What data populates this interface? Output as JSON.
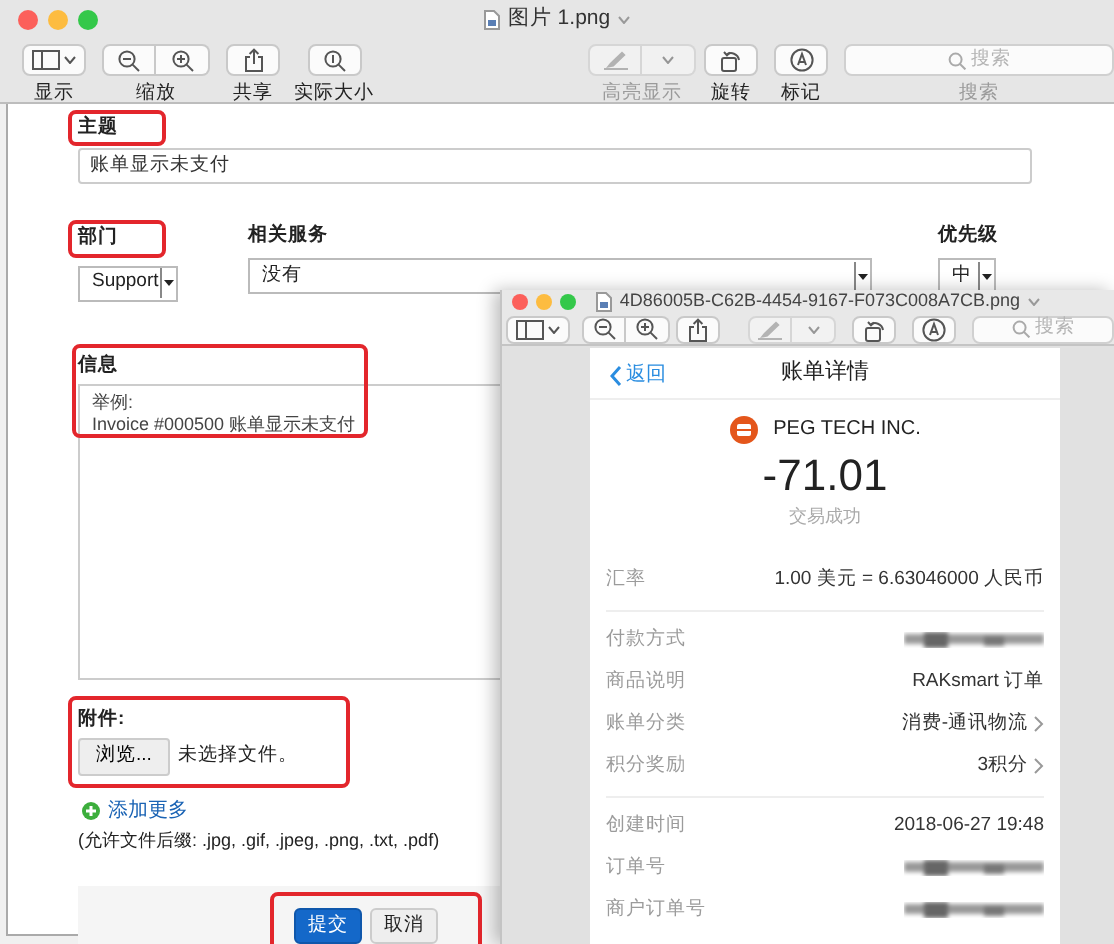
{
  "window": {
    "title": "图片 1.png"
  },
  "toolbar": [
    {
      "label": "显示",
      "kind": "sidebar",
      "disabled": false
    },
    {
      "label": "缩放",
      "kind": "zoom",
      "disabled": false
    },
    {
      "label": "共享",
      "kind": "share",
      "disabled": false
    },
    {
      "label": "实际大小",
      "kind": "actual",
      "disabled": false
    },
    {
      "label": "高亮显示",
      "kind": "highlight",
      "disabled": true
    },
    {
      "label": "旋转",
      "kind": "rotate",
      "disabled": false
    },
    {
      "label": "标记",
      "kind": "markup",
      "disabled": false
    }
  ],
  "search": {
    "placeholder": "搜索",
    "label": "搜索"
  },
  "form": {
    "subject": {
      "label": "主题",
      "value": "账单显示未支付",
      "annotated": true
    },
    "department": {
      "label": "部门",
      "value": "Support",
      "annotated": true
    },
    "service": {
      "label": "相关服务",
      "value": "没有"
    },
    "priority": {
      "label": "优先级",
      "value": "中"
    },
    "message": {
      "label": "信息",
      "placeholder": "举例:\nInvoice #000500 账单显示未支付",
      "annotated": true
    },
    "attachment": {
      "label": "附件:",
      "button": "浏览...",
      "status": "未选择文件。",
      "annotated": true
    },
    "add_more": "添加更多",
    "allowed": "(允许文件后缀: .jpg, .gif, .jpeg, .png, .txt, .pdf)",
    "buttons": [
      {
        "label": "提交",
        "kind": "primary"
      },
      {
        "label": "取消",
        "kind": "secondary"
      }
    ],
    "buttons_annotated": true
  },
  "second_window": {
    "title": "4D86005B-C62B-4454-9167-F073C008A7CB.png",
    "search": {
      "placeholder": "搜索"
    },
    "receipt": {
      "back": "返回",
      "title": "账单详情",
      "merchant": "PEG TECH INC.",
      "amount": "-71.01",
      "status": "交易成功",
      "groups": [
        [
          {
            "label": "汇率",
            "value": "1.00 美元 = 6.63046000 人民币",
            "redacted": false,
            "link": false
          }
        ],
        [
          {
            "label": "付款方式",
            "redacted": true,
            "link": false
          },
          {
            "label": "商品说明",
            "value": "RAKsmart 订单",
            "redacted": false,
            "link": false
          },
          {
            "label": "账单分类",
            "value": "消费-通讯物流",
            "redacted": false,
            "link": true
          },
          {
            "label": "积分奖励",
            "value": "3积分",
            "redacted": false,
            "link": true
          }
        ],
        [
          {
            "label": "创建时间",
            "value": "2018-06-27 19:48",
            "redacted": false,
            "link": false
          },
          {
            "label": "订单号",
            "redacted": true,
            "link": false
          },
          {
            "label": "商户订单号",
            "redacted": true,
            "link": false
          }
        ]
      ]
    }
  }
}
